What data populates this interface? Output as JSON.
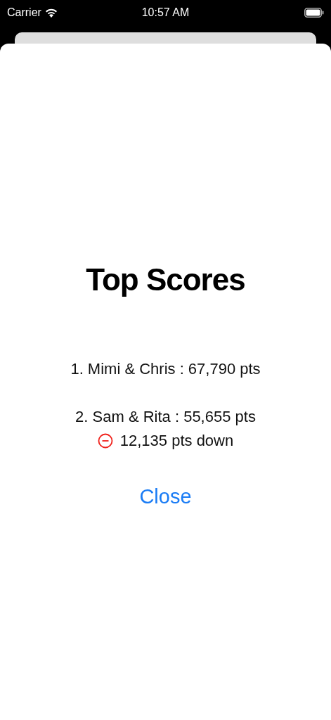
{
  "status_bar": {
    "carrier": "Carrier",
    "time": "10:57 AM"
  },
  "sheet": {
    "title": "Top Scores",
    "entries": [
      {
        "text": "1. Mimi & Chris : 67,790 pts"
      },
      {
        "text": "2. Sam & Rita : 55,655 pts",
        "deficit": "12,135 pts down"
      }
    ],
    "close_button": "Close"
  }
}
